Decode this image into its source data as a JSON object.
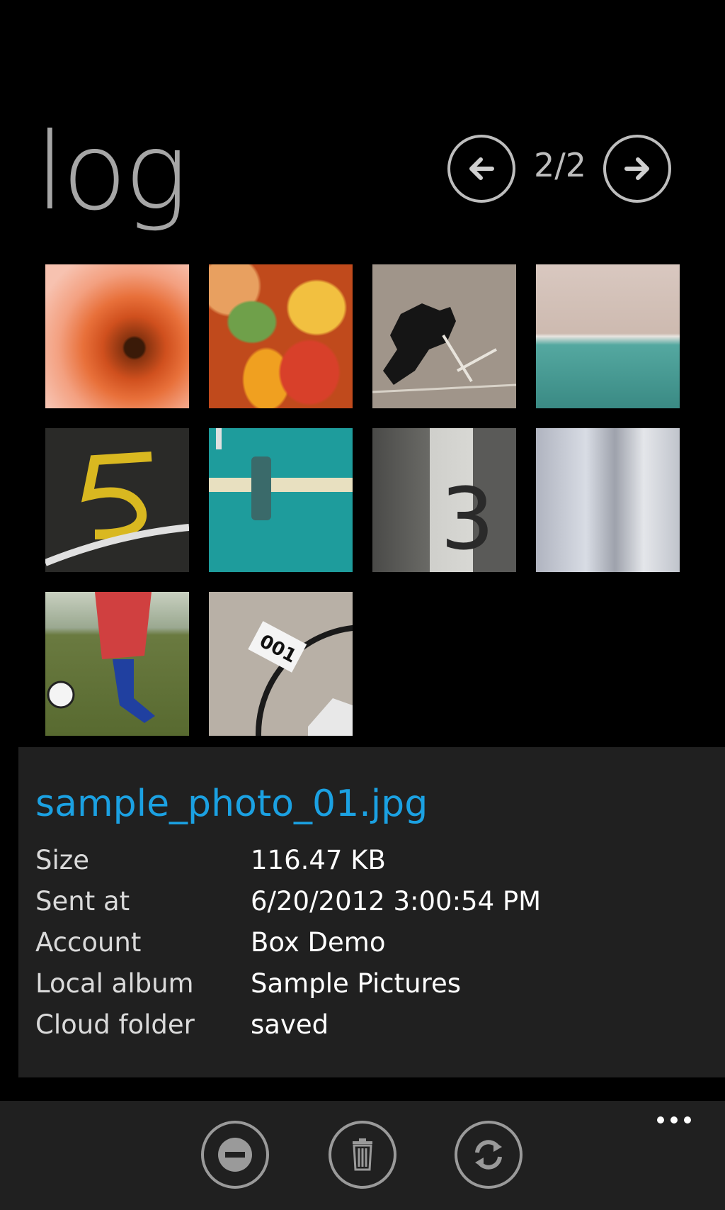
{
  "page": {
    "title": "log",
    "pager": {
      "indicator": "2/2",
      "prev_icon": "arrow-left-icon",
      "next_icon": "arrow-right-icon"
    }
  },
  "thumbnails": [
    {
      "name": "thumb-flower"
    },
    {
      "name": "thumb-fruit"
    },
    {
      "name": "thumb-shadow-jump"
    },
    {
      "name": "thumb-pool"
    },
    {
      "name": "thumb-number-5"
    },
    {
      "name": "thumb-teal-door"
    },
    {
      "name": "thumb-pillar-3"
    },
    {
      "name": "thumb-white-pillar"
    },
    {
      "name": "thumb-soccer"
    },
    {
      "name": "thumb-bicycle-001"
    }
  ],
  "details": {
    "file_name": "sample_photo_01.jpg",
    "rows": [
      {
        "label": "Size",
        "value": "116.47 KB"
      },
      {
        "label": "Sent at",
        "value": "6/20/2012 3:00:54 PM"
      },
      {
        "label": "Account",
        "value": "Box Demo"
      },
      {
        "label": "Local album",
        "value": "Sample Pictures"
      },
      {
        "label": "Cloud folder",
        "value": "saved"
      }
    ]
  },
  "appbar": {
    "buttons": [
      {
        "name": "remove-button",
        "icon": "minus-icon"
      },
      {
        "name": "delete-button",
        "icon": "trash-icon"
      },
      {
        "name": "sync-button",
        "icon": "sync-icon"
      }
    ],
    "more_icon": "ellipsis-icon"
  },
  "colors": {
    "accent": "#1ba1e2",
    "background": "#000000",
    "panel": "#202020"
  }
}
